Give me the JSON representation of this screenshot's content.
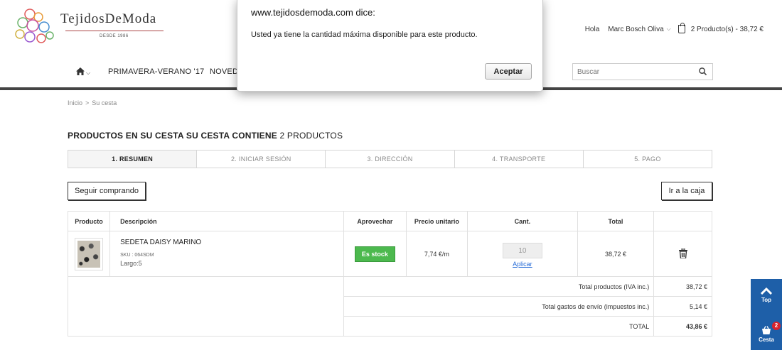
{
  "header": {
    "logo_text": "TejidosDeModa",
    "logo_since": "DESDE 1986",
    "greeting": "Hola",
    "user_name": "Marc Bosch Oliva",
    "cart_summary": "2 Producto(s) - 38,72 €"
  },
  "nav": {
    "items": [
      "PRIMAVERA-VERANO '17",
      "NOVEDA"
    ]
  },
  "search": {
    "placeholder": "Buscar"
  },
  "breadcrumb": {
    "home": "Inicio",
    "separator": ">",
    "current": "Su cesta"
  },
  "page_title": {
    "main": "PRODUCTOS EN SU CESTA SU CESTA CONTIENE",
    "count": "2 PRODUCTOS"
  },
  "steps": [
    "1. RESUMEN",
    "2. INICIAR SESIÓN",
    "3. DIRECCIÓN",
    "4. TRANSPORTE",
    "5. PAGO"
  ],
  "buttons": {
    "continue_shopping": "Seguir comprando",
    "checkout": "Ir a la caja"
  },
  "cart_table": {
    "headers": [
      "Producto",
      "Descripción",
      "Aprovechar",
      "Precio unitario",
      "Cant.",
      "Total"
    ],
    "rows": [
      {
        "name": "SEDETA DAISY MARINO",
        "sku": "SKU : 064SDM",
        "length": "Largo:5",
        "status": "Es stock",
        "unit_price": "7,74 €/m",
        "qty": "10",
        "apply": "Aplicar",
        "total": "38,72 €"
      }
    ],
    "totals": [
      {
        "label": "Total productos (IVA inc.)",
        "value": "38,72 €"
      },
      {
        "label": "Total gastos de envío (impuestos inc.)",
        "value": "5,14 €"
      },
      {
        "label": "TOTAL",
        "value": "43,86 €"
      }
    ]
  },
  "side_widget": {
    "top_label": "Top",
    "cart_label": "Cesta",
    "cart_count": "2"
  },
  "dialog": {
    "title": "www.tejidosdemoda.com dice:",
    "message": "Usted ya tiene la cantidad máxima disponible para este producto.",
    "button": "Aceptar"
  },
  "colors": {
    "accent_blue": "#1e5fa8",
    "stock_green": "#4cb94e",
    "badge_red": "#d9232d",
    "link_blue": "#2a6ed8"
  }
}
